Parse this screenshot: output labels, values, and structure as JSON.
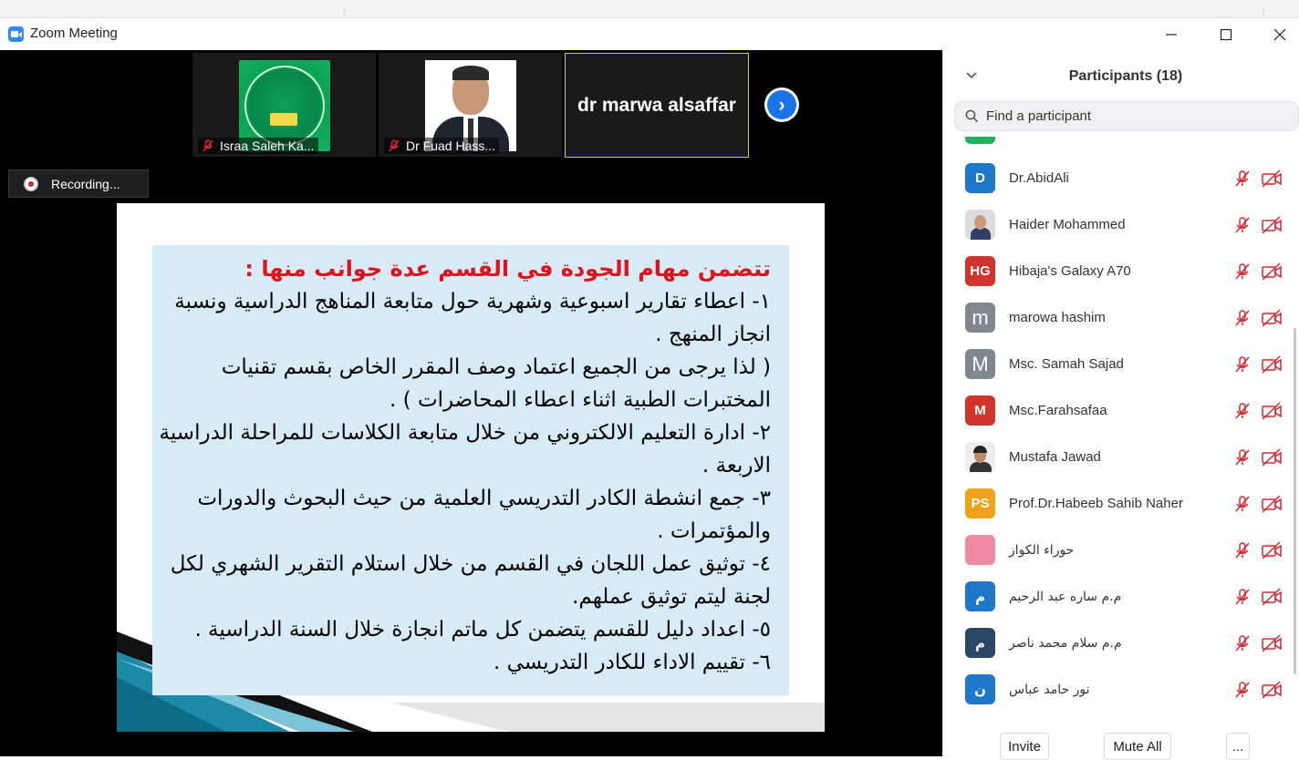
{
  "window": {
    "title": "Zoom Meeting"
  },
  "thumbnails": [
    {
      "name": "Israa Saleh Ka..."
    },
    {
      "name": "Dr Fuad Hass..."
    }
  ],
  "name_tile": {
    "name": "dr marwa alsaffar"
  },
  "recording": {
    "label": "Recording..."
  },
  "slide": {
    "heading": "تتضمن مهام الجودة في القسم عدة جوانب منها :",
    "lines": [
      "١- اعطاء تقارير اسبوعية وشهرية حول متابعة المناهج الدراسية ونسبة",
      "انجاز المنهج .",
      "( لذا يرجى من الجميع اعتماد وصف المقرر الخاص بقسم تقنيات",
      "المختبرات الطبية اثناء اعطاء المحاضرات ) .",
      "٢- ادارة التعليم الالكتروني من خلال متابعة الكلاسات للمراحلة الدراسية",
      "الاربعة .",
      "٣- جمع انشطة الكادر التدريسي العلمية من حيث البحوث والدورات",
      "والمؤتمرات .",
      "٤- توثيق عمل اللجان في القسم من خلال استلام التقرير الشهري لكل",
      "لجنة ليتم توثيق عملهم.",
      "٥- اعداد دليل للقسم يتضمن كل ماتم انجازة خلال السنة الدراسية .",
      "٦- تقييم الاداء للكادر التدريسي ."
    ]
  },
  "participants_panel": {
    "title": "Participants (18)",
    "search_placeholder": "Find a participant",
    "participants": [
      {
        "initials": "D",
        "name": "Dr.AbidAli",
        "avatar_color": "#1e77c8",
        "avatar_type": "initials"
      },
      {
        "initials": "",
        "name": "Haider Mohammed",
        "avatar_color": "#dcdcdc",
        "avatar_type": "photo-woman"
      },
      {
        "initials": "HG",
        "name": "Hibaja's Galaxy A70",
        "avatar_color": "#d0342c",
        "avatar_type": "initials"
      },
      {
        "initials": "m",
        "name": "marowa hashim",
        "avatar_color": "#7f8890",
        "avatar_type": "initials-light"
      },
      {
        "initials": "M",
        "name": "Msc. Samah Sajad",
        "avatar_color": "#7f8890",
        "avatar_type": "initials-light"
      },
      {
        "initials": "M",
        "name": "Msc.Farahsafaa",
        "avatar_color": "#d0342c",
        "avatar_type": "initials"
      },
      {
        "initials": "",
        "name": "Mustafa Jawad",
        "avatar_color": "#eeeeee",
        "avatar_type": "photo-man"
      },
      {
        "initials": "PS",
        "name": "Prof.Dr.Habeeb Sahib Naher",
        "avatar_color": "#f0a21c",
        "avatar_type": "initials"
      },
      {
        "initials": "",
        "name": "حوراء الكواز",
        "avatar_color": "#ef8aa0",
        "avatar_type": "photo-rose"
      },
      {
        "initials": "م",
        "name": "م.م ساره عبد الرحيم",
        "avatar_color": "#1e77c8",
        "avatar_type": "initials"
      },
      {
        "initials": "م",
        "name": "م.م سلام محمد ناصر",
        "avatar_color": "#2b4766",
        "avatar_type": "initials"
      },
      {
        "initials": "ن",
        "name": "نور حامد عباس",
        "avatar_color": "#1e77c8",
        "avatar_type": "initials"
      }
    ],
    "footer": {
      "invite": "Invite",
      "mute_all": "Mute All",
      "more": "..."
    }
  },
  "colors": {
    "accent_blue": "#1a73e8",
    "muted_red": "#d6262d",
    "slide_bg": "#d6ebf5",
    "heading_red": "#e0121c"
  }
}
